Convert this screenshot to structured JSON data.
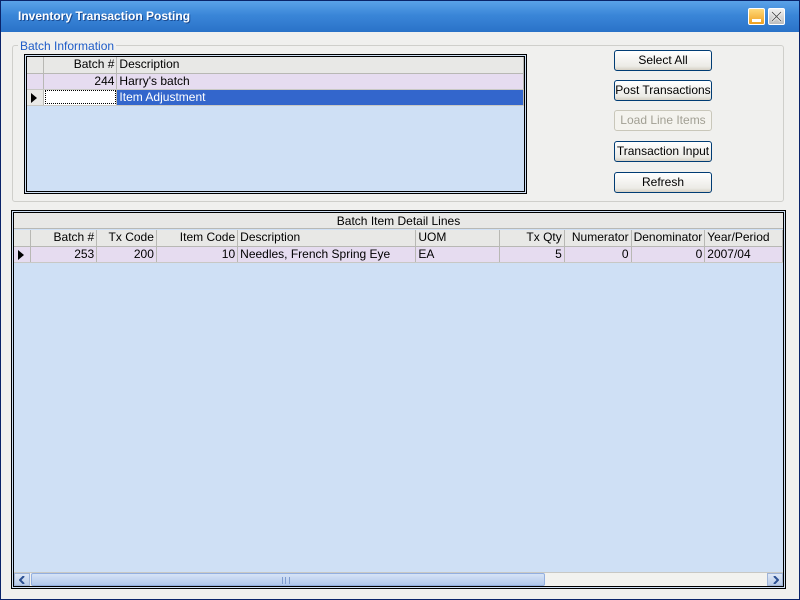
{
  "window": {
    "title": "Inventory Transaction Posting"
  },
  "batch_group": {
    "label": "Batch Information",
    "columns": [
      "Batch #",
      "Description"
    ],
    "rows": [
      {
        "batch": "244",
        "description": "Harry's batch"
      },
      {
        "batch": "",
        "description": "Item Adjustment"
      }
    ]
  },
  "buttons": {
    "select_all": "Select All",
    "post_transactions": "Post Transactions",
    "load_line_items": "Load Line Items",
    "transaction_input": "Transaction Input",
    "refresh": "Refresh"
  },
  "detail": {
    "caption": "Batch Item Detail Lines",
    "columns": [
      "Batch #",
      "Tx Code",
      "Item Code",
      "Description",
      "UOM",
      "Tx Qty",
      "Numerator",
      "Denominator",
      "Year/Period"
    ],
    "rows": [
      {
        "batch": "253",
        "tx_code": "200",
        "item_code": "10",
        "description": "Needles, French Spring Eye",
        "uom": "EA",
        "tx_qty": "5",
        "numerator": "0",
        "denominator": "0",
        "year_period": "2007/04"
      }
    ]
  }
}
